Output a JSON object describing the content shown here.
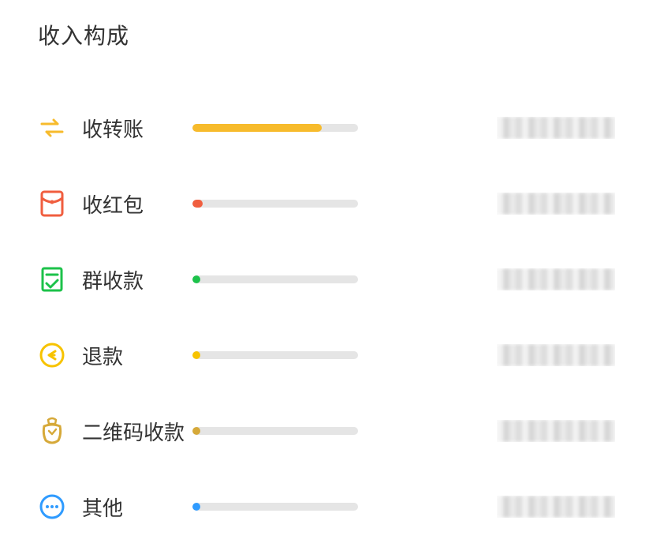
{
  "title": "收入构成",
  "items": [
    {
      "icon": "transfer-icon",
      "label": "收转账",
      "color": "#F7BB2C",
      "percent": 78
    },
    {
      "icon": "redpacket-icon",
      "label": "收红包",
      "color": "#F05E3F",
      "percent": 6
    },
    {
      "icon": "groupcollect-icon",
      "label": "群收款",
      "color": "#1CC24A",
      "percent": 4
    },
    {
      "icon": "refund-icon",
      "label": "退款",
      "color": "#F7C300",
      "percent": 4
    },
    {
      "icon": "qrcollect-icon",
      "label": "二维码收款",
      "color": "#D6A939",
      "percent": 4
    },
    {
      "icon": "other-icon",
      "label": "其他",
      "color": "#2F9BFF",
      "percent": 4
    }
  ],
  "chart_data": {
    "type": "bar",
    "title": "收入构成",
    "categories": [
      "收转账",
      "收红包",
      "群收款",
      "退款",
      "二维码收款",
      "其他"
    ],
    "values": [
      78,
      6,
      4,
      4,
      4,
      4
    ],
    "colors": [
      "#F7BB2C",
      "#F05E3F",
      "#1CC24A",
      "#F7C300",
      "#D6A939",
      "#2F9BFF"
    ],
    "xlabel": "",
    "ylabel": "",
    "ylim": [
      0,
      100
    ],
    "note": "Amount values on the right are obscured/pixelated in the source image and not readable."
  }
}
